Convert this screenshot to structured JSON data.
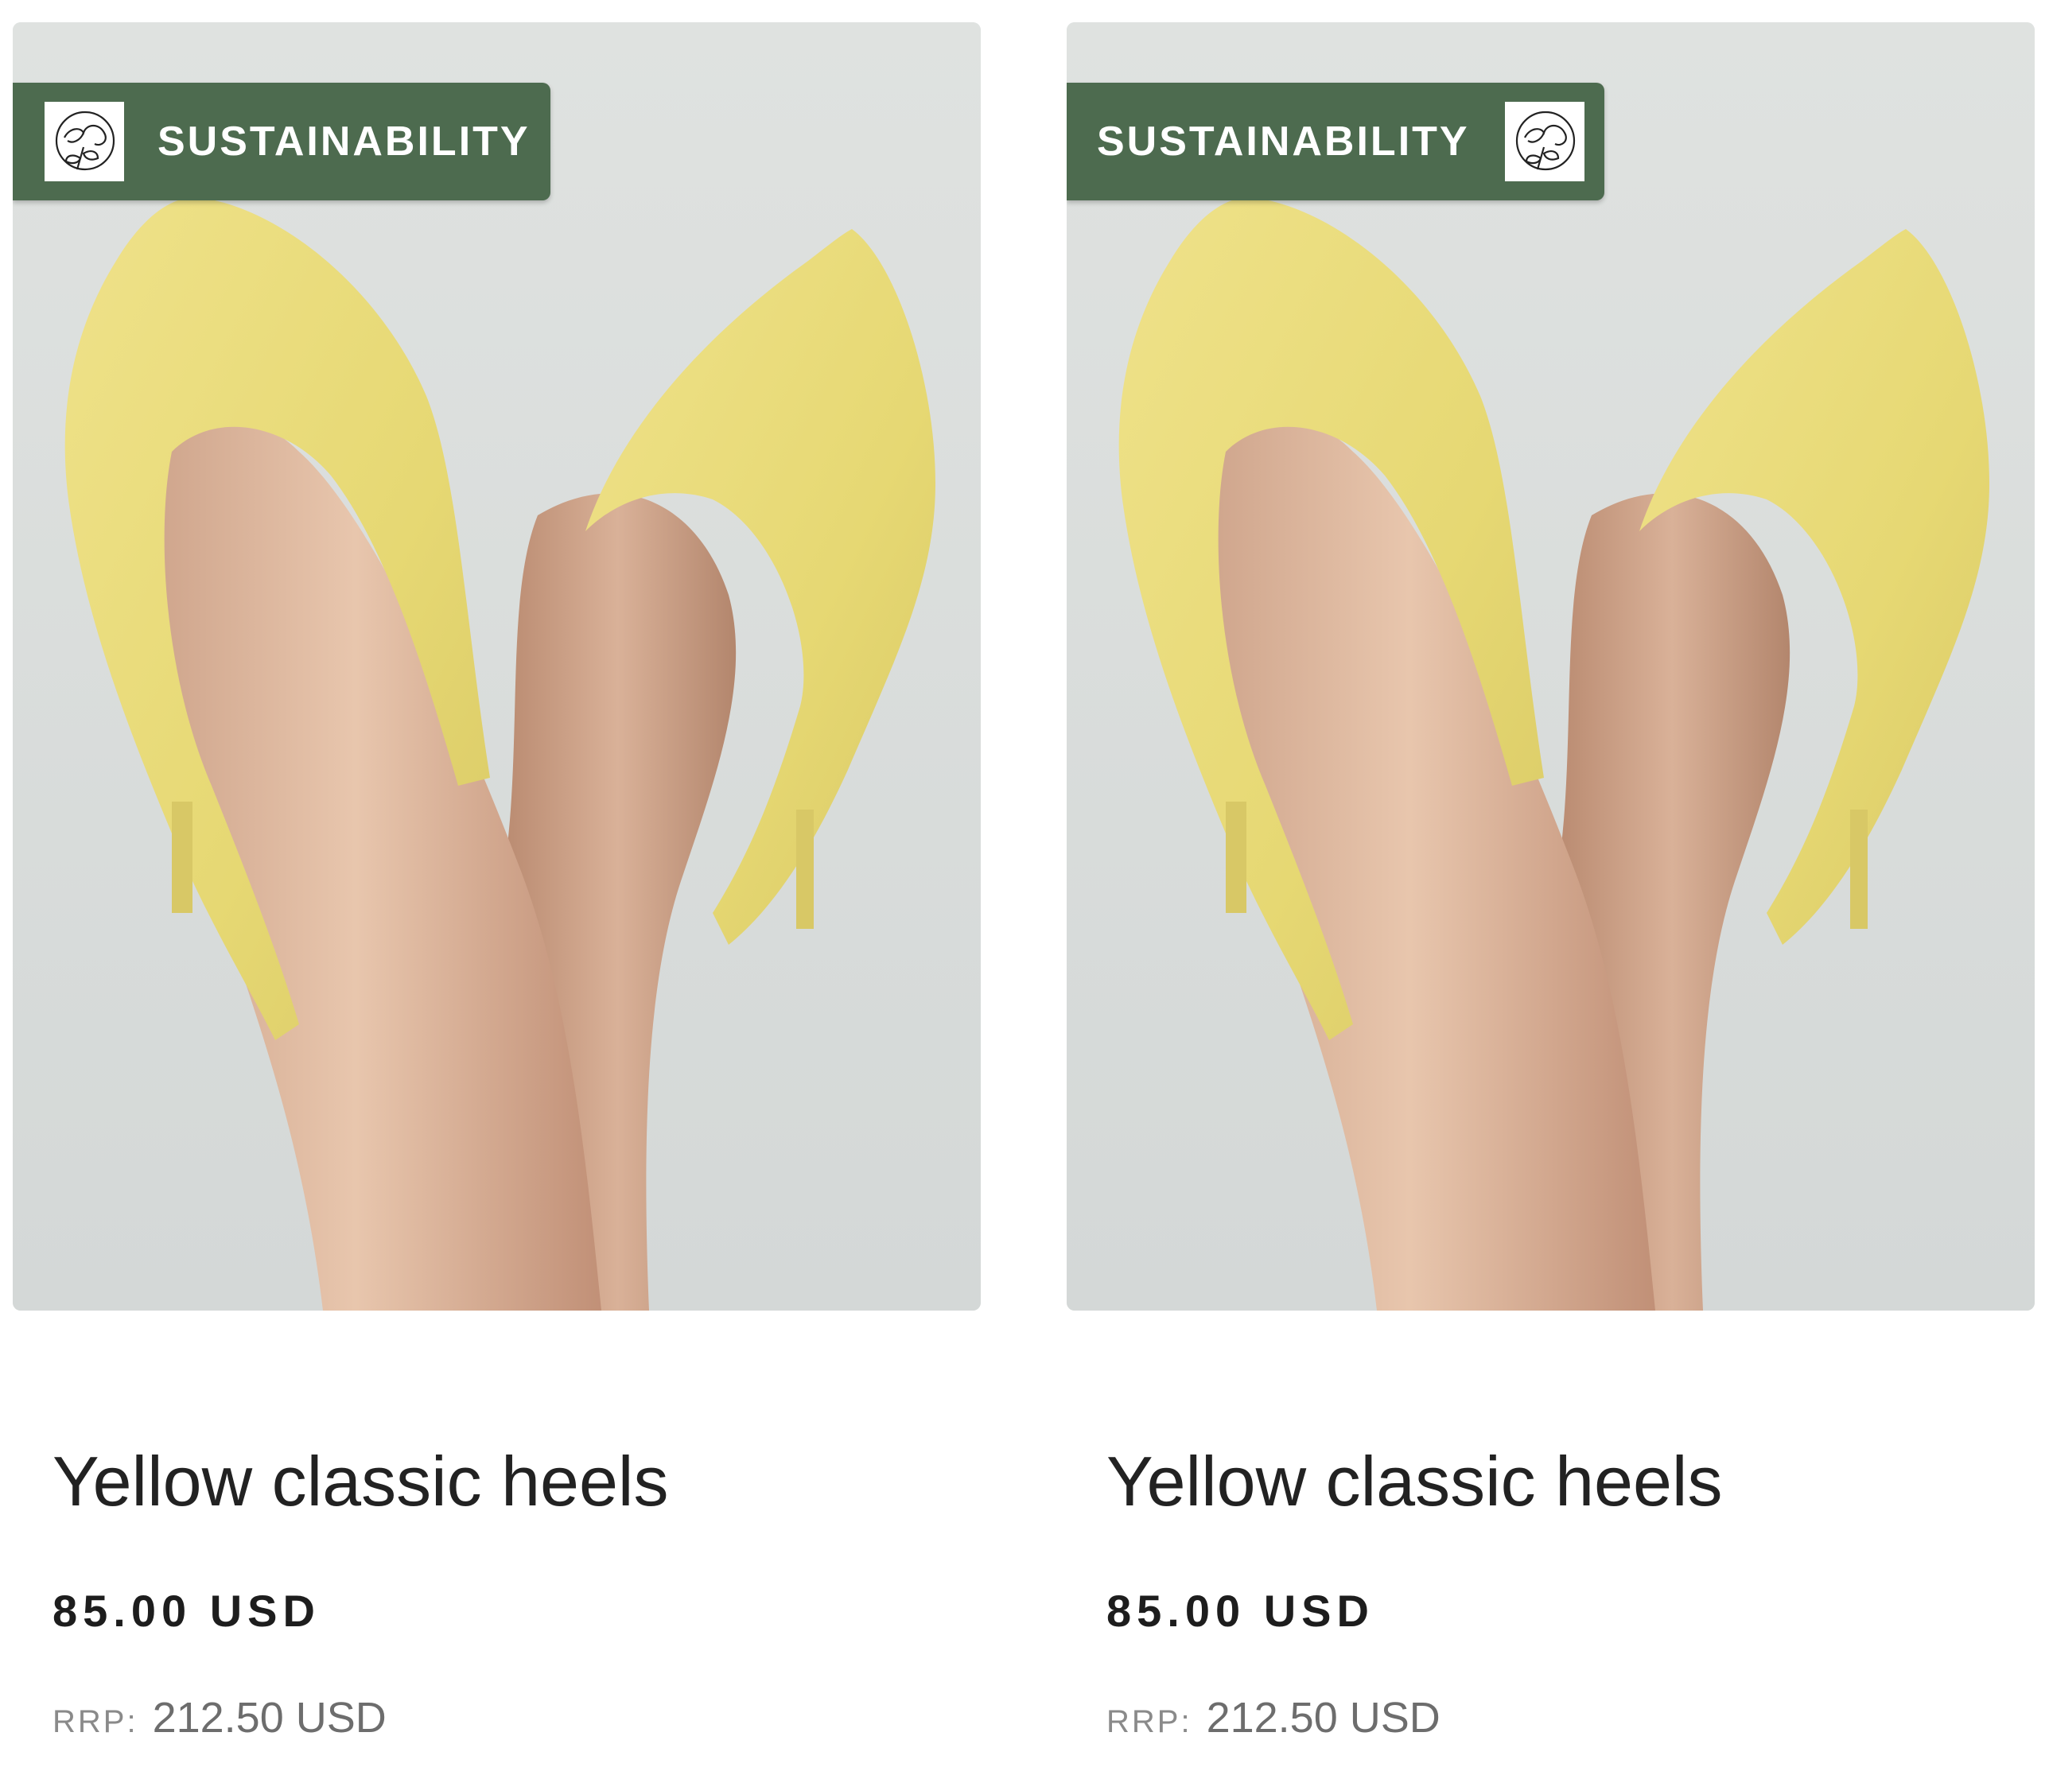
{
  "products": [
    {
      "badge": {
        "label": "SUSTAINABILITY",
        "icon": "cotton-plant-icon",
        "icon_side": "left",
        "color": "#4d6b4f"
      },
      "image": {
        "alt": "Yellow classic heels",
        "shoe_color": "#e8dc7a",
        "background_color": "#dfe2e1"
      },
      "name": "Yellow classic heels",
      "price": "85.00 USD",
      "rrp_label": "RRP:",
      "rrp_value": "212.50 USD"
    },
    {
      "badge": {
        "label": "SUSTAINABILITY",
        "icon": "cotton-plant-icon",
        "icon_side": "right",
        "color": "#4d6b4f"
      },
      "image": {
        "alt": "Yellow classic heels",
        "shoe_color": "#e8dc7a",
        "background_color": "#dfe2e1"
      },
      "name": "Yellow classic heels",
      "price": "85.00 USD",
      "rrp_label": "RRP:",
      "rrp_value": "212.50 USD"
    }
  ]
}
